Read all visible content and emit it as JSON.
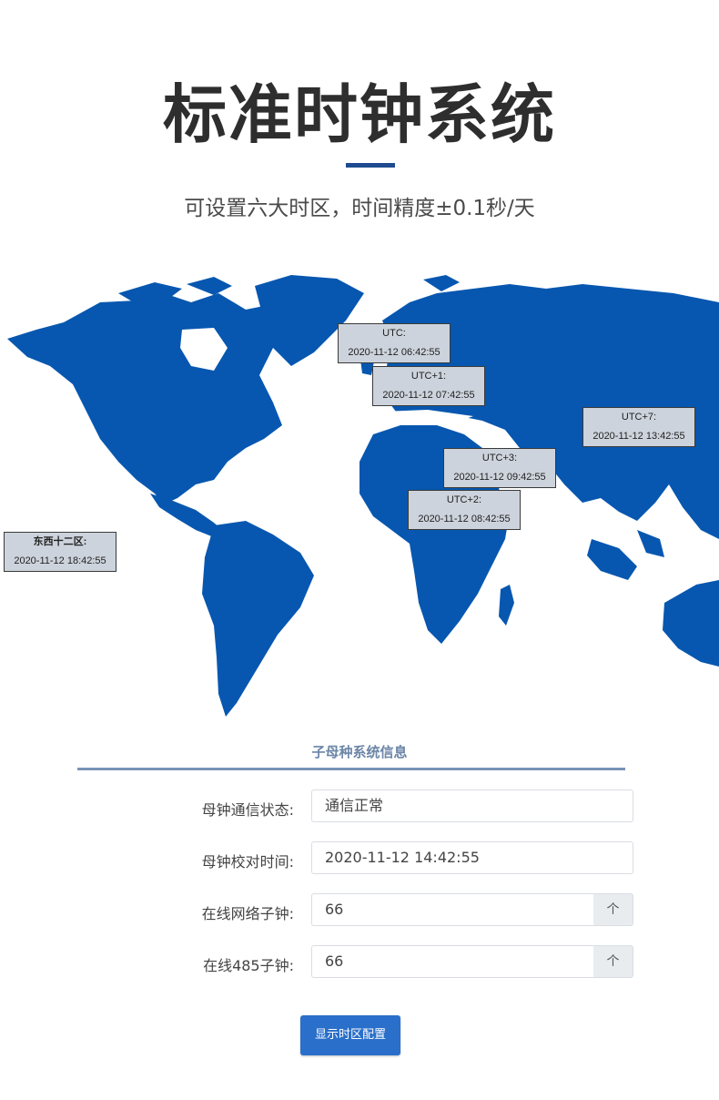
{
  "header": {
    "title": "标准时钟系统",
    "subtitle": "可设置六大时区，时间精度±0.1秒/天"
  },
  "map": {
    "land_color": "#0757b0",
    "zones": [
      {
        "name": "UTC:",
        "time": "2020-11-12 06:42:55"
      },
      {
        "name": "UTC+1:",
        "time": "2020-11-12 07:42:55"
      },
      {
        "name": "UTC+7:",
        "time": "2020-11-12 13:42:55"
      },
      {
        "name": "UTC+3:",
        "time": "2020-11-12 09:42:55"
      },
      {
        "name": "UTC+2:",
        "time": "2020-11-12 08:42:55"
      },
      {
        "name": "东西十二区:",
        "time": "2020-11-12 18:42:55"
      }
    ]
  },
  "panel": {
    "title": "子母种系统信息",
    "rows": [
      {
        "label": "母钟通信状态:",
        "value": "通信正常"
      },
      {
        "label": "母钟校对时间:",
        "value": "2020-11-12 14:42:55"
      },
      {
        "label": "在线网络子钟:",
        "value": "66",
        "addon": "个"
      },
      {
        "label": "在线485子钟:",
        "value": "66",
        "addon": "个"
      }
    ],
    "button_label": "显示时区配置"
  },
  "colors": {
    "accent": "#1f4a8f",
    "button": "#2a6fc9"
  }
}
